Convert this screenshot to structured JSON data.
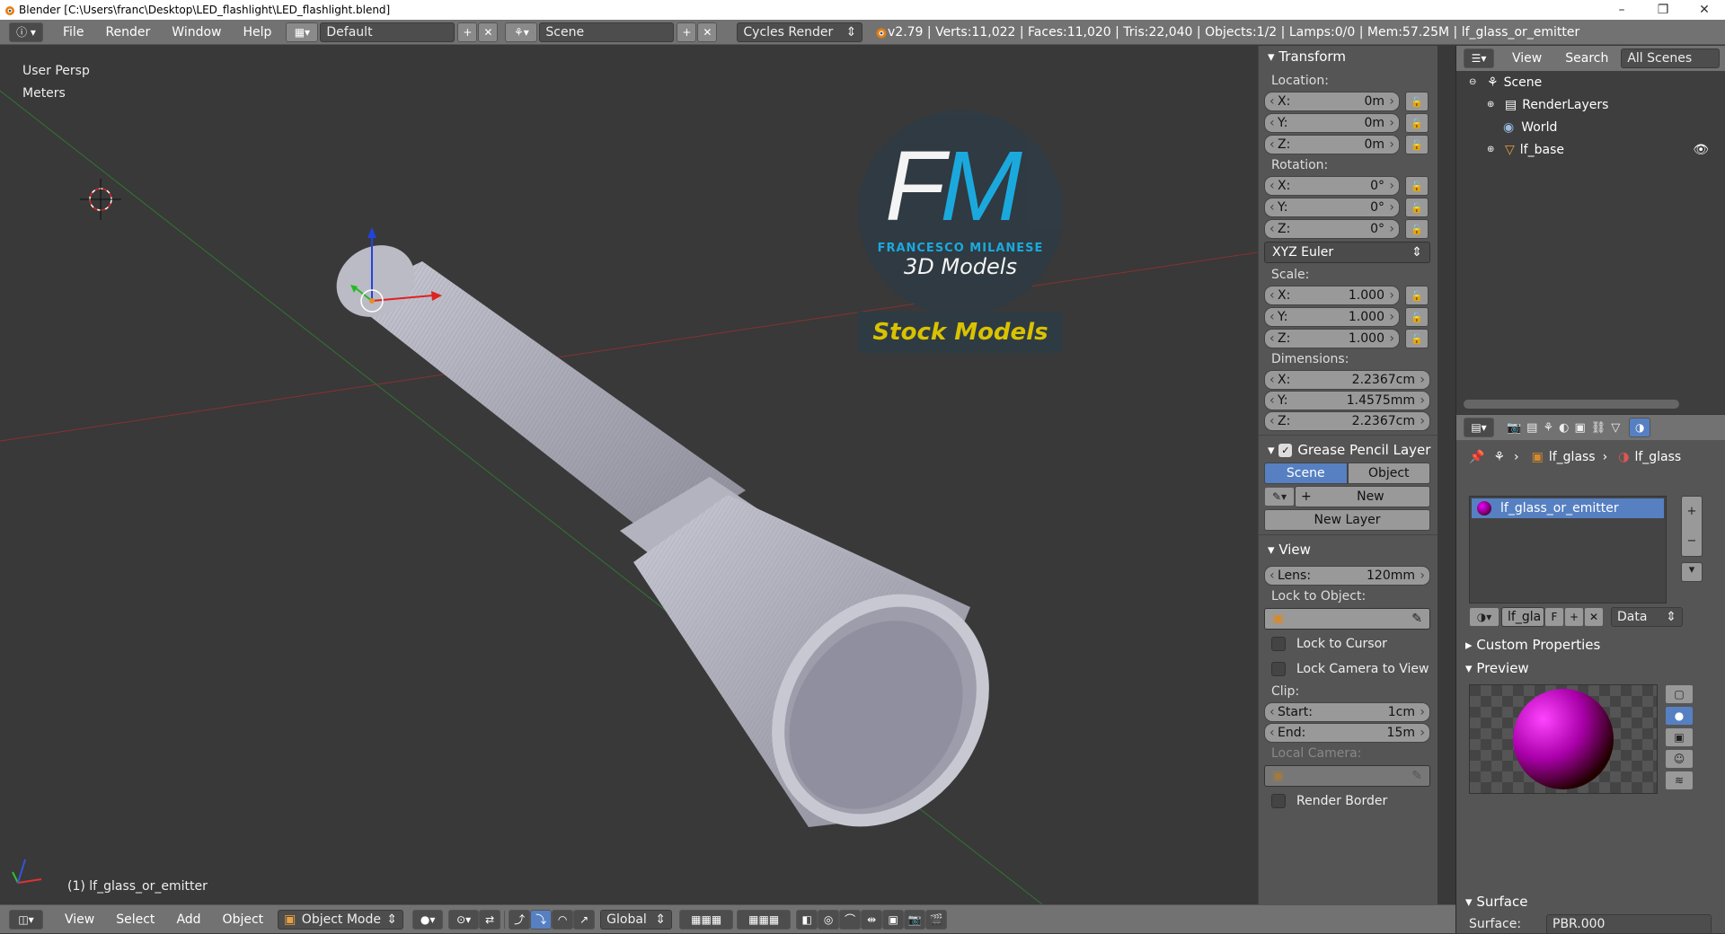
{
  "window": {
    "title": "Blender [C:\\Users\\franc\\Desktop\\LED_flashlight\\LED_flashlight.blend]",
    "minimize": "–",
    "maximize": "❐",
    "close": "✕"
  },
  "topbar": {
    "menus": [
      "File",
      "Render",
      "Window",
      "Help"
    ],
    "layout": "Default",
    "scene": "Scene",
    "engine": "Cycles Render",
    "info": "v2.79 | Verts:11,022 | Faces:11,020 | Tris:22,040 | Objects:1/2 | Lamps:0/0 | Mem:57.25M | lf_glass_or_emitter"
  },
  "viewport": {
    "view_name": "User Persp",
    "units": "Meters",
    "object_label": "(1) lf_glass_or_emitter",
    "watermark": {
      "initials_f": "F",
      "initials_m": "M",
      "author": "FRANCESCO MILANESE",
      "subtitle": "3D Models",
      "banner": "Stock Models"
    }
  },
  "npanel": {
    "transform_title": "Transform",
    "location_label": "Location:",
    "location": {
      "x": "0m",
      "y": "0m",
      "z": "0m"
    },
    "rotation_label": "Rotation:",
    "rotation": {
      "x": "0°",
      "y": "0°",
      "z": "0°"
    },
    "rotation_mode": "XYZ Euler",
    "scale_label": "Scale:",
    "scale": {
      "x": "1.000",
      "y": "1.000",
      "z": "1.000"
    },
    "dimensions_label": "Dimensions:",
    "dimensions": {
      "x": "2.2367cm",
      "y": "1.4575mm",
      "z": "2.2367cm"
    },
    "axis": {
      "x": "X:",
      "y": "Y:",
      "z": "Z:"
    },
    "grease_title": "Grease Pencil Layer",
    "grease_scene": "Scene",
    "grease_object": "Object",
    "grease_new": "New",
    "grease_new_layer": "New Layer",
    "view_title": "View",
    "lens_label": "Lens:",
    "lens_value": "120mm",
    "lock_to_object": "Lock to Object:",
    "lock_to_cursor": "Lock to Cursor",
    "lock_camera": "Lock Camera to View",
    "clip_label": "Clip:",
    "clip_start_label": "Start:",
    "clip_start": "1cm",
    "clip_end_label": "End:",
    "clip_end": "15m",
    "local_camera": "Local Camera:",
    "render_border": "Render Border"
  },
  "outliner": {
    "view": "View",
    "search": "Search",
    "filter": "All Scenes",
    "items": [
      "Scene",
      "RenderLayers",
      "World",
      "lf_base"
    ]
  },
  "properties": {
    "breadcrumb_obj": "lf_glass",
    "breadcrumb_mat": "lf_glass",
    "material_slot": "lf_glass_or_emitter",
    "material_field": "lf_gla",
    "fake_user": "F",
    "link": "Data",
    "custom_props": "Custom Properties",
    "preview": "Preview",
    "surface_title": "Surface",
    "surface_label": "Surface:",
    "surface_value": "PBR.000"
  },
  "bottombar": {
    "menus": [
      "View",
      "Select",
      "Add",
      "Object"
    ],
    "mode": "Object Mode",
    "orientation": "Global"
  },
  "colors": {
    "accent": "#5680c2",
    "watermark_cyan": "#1ab0e6",
    "watermark_yellow": "#d9c200"
  }
}
